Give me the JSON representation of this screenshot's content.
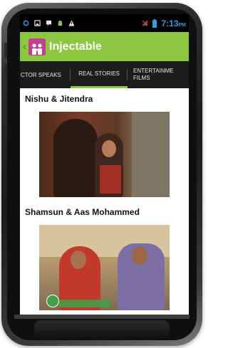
{
  "status_bar": {
    "time": "7:13",
    "ampm": "PM",
    "icons": [
      "settings-icon",
      "image-icon",
      "message-icon",
      "android-icon",
      "warning-icon",
      "no-signal-icon",
      "battery-icon"
    ]
  },
  "action_bar": {
    "title": "Injectable",
    "back_icon": "back-chevron-icon",
    "logo_icon": "family-logo-icon"
  },
  "tabs": [
    {
      "label": "CTOR SPEAKS",
      "selected": false
    },
    {
      "label": "REAL STORIES",
      "selected": true
    },
    {
      "label_line1": "ENTERTAINME",
      "label_line2": "FILMS",
      "selected": false
    }
  ],
  "stories": [
    {
      "title": "Nishu & Jitendra"
    },
    {
      "title": "Shamsun & Aas Mohammed"
    }
  ],
  "colors": {
    "accent": "#8dc63f",
    "status_text": "#2f9fe0",
    "logo": "#c2408f"
  }
}
